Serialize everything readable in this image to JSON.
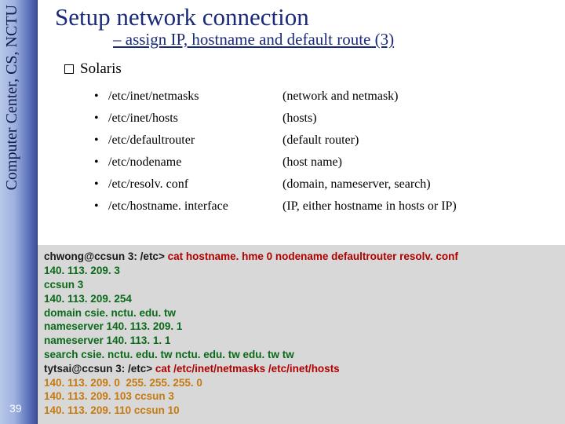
{
  "sidebar": {
    "label": "Computer Center, CS, NCTU",
    "page_number": "39"
  },
  "header": {
    "title": "Setup network connection",
    "subtitle": "– assign IP, hostname and default route (3)"
  },
  "section": {
    "label": "Solaris",
    "items": [
      {
        "path": "/etc/inet/netmasks",
        "desc": "(network and netmask)"
      },
      {
        "path": "/etc/inet/hosts",
        "desc": "(hosts)"
      },
      {
        "path": "/etc/defaultrouter",
        "desc": "(default router)"
      },
      {
        "path": "/etc/nodename",
        "desc": "(host name)"
      },
      {
        "path": "/etc/resolv. conf",
        "desc": "(domain, nameserver, search)"
      },
      {
        "path": "/etc/hostname. interface",
        "desc": "(IP, either hostname in hosts or IP)"
      }
    ]
  },
  "terminal": {
    "segments": [
      [
        {
          "cls": "t-dark",
          "text": "chwong@ccsun 3: /etc> "
        },
        {
          "cls": "t-red",
          "text": "cat hostname. hme 0 nodename defaultrouter resolv. conf"
        }
      ],
      [
        {
          "cls": "t-green",
          "text": "140. 113. 209. 3"
        }
      ],
      [
        {
          "cls": "t-green",
          "text": "ccsun 3"
        }
      ],
      [
        {
          "cls": "t-green",
          "text": "140. 113. 209. 254"
        }
      ],
      [
        {
          "cls": "t-green",
          "text": "domain csie. nctu. edu. tw"
        }
      ],
      [
        {
          "cls": "t-green",
          "text": "nameserver 140. 113. 209. 1"
        }
      ],
      [
        {
          "cls": "t-green",
          "text": "nameserver 140. 113. 1. 1"
        }
      ],
      [
        {
          "cls": "t-green",
          "text": "search csie. nctu. edu. tw nctu. edu. tw edu. tw tw"
        }
      ],
      [
        {
          "cls": "t-dark",
          "text": "tytsai@ccsun 3: /etc> "
        },
        {
          "cls": "t-red",
          "text": "cat /etc/inet/netmasks /etc/inet/hosts"
        }
      ],
      [
        {
          "cls": "t-orange",
          "text": "140. 113. 209. 0  255. 255. 255. 0"
        }
      ],
      [
        {
          "cls": "t-orange",
          "text": "140. 113. 209. 103 ccsun 3"
        }
      ],
      [
        {
          "cls": "t-orange",
          "text": "140. 113. 209. 110 ccsun 10"
        }
      ]
    ]
  }
}
